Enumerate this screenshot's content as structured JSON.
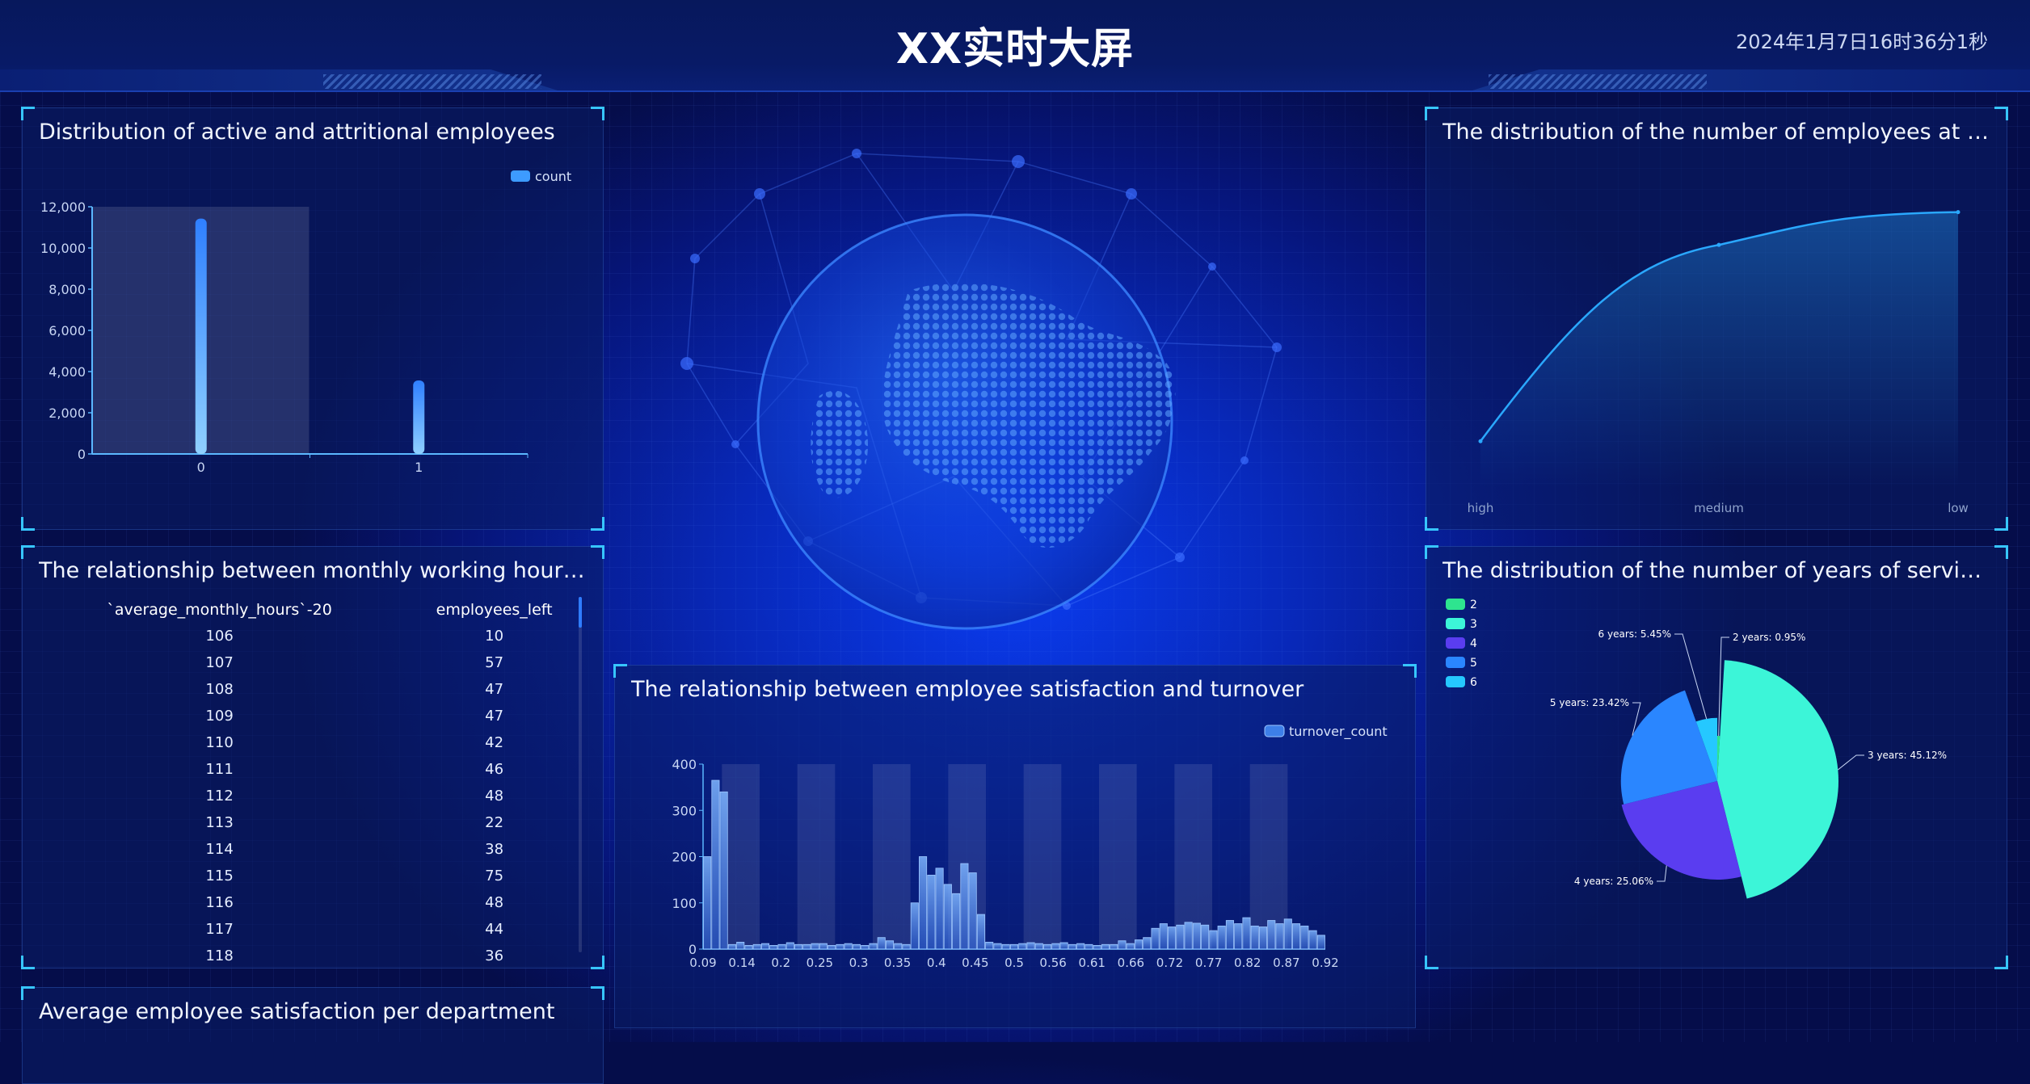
{
  "header": {
    "title": "XX实时大屏",
    "datetime": "2024年1月7日16时36分1秒"
  },
  "panels": {
    "bar": {
      "title": "Distribution of active and attritional employees"
    },
    "line": {
      "title": "The distribution of the number of employees at differ..."
    },
    "table": {
      "title": "The relationship between monthly working hours and ..."
    },
    "pie": {
      "title": "The distribution of the number of years of service of t..."
    },
    "hist": {
      "title": "The relationship between employee satisfaction and turnover"
    },
    "dept": {
      "title": "Average employee satisfaction per department"
    }
  },
  "table": {
    "columns": [
      "`average_monthly_hours`-20",
      "employees_left"
    ],
    "rows": [
      [
        "106",
        "10"
      ],
      [
        "107",
        "57"
      ],
      [
        "108",
        "47"
      ],
      [
        "109",
        "47"
      ],
      [
        "110",
        "42"
      ],
      [
        "111",
        "46"
      ],
      [
        "112",
        "48"
      ],
      [
        "113",
        "22"
      ],
      [
        "114",
        "38"
      ],
      [
        "115",
        "75"
      ],
      [
        "116",
        "48"
      ],
      [
        "117",
        "44"
      ],
      [
        "118",
        "36"
      ]
    ]
  },
  "colors": {
    "accent": "#37c6ff",
    "bar": "#3d9bff",
    "pie": [
      "#2ee48f",
      "#3cf5d8",
      "#5a3df0",
      "#2a86ff",
      "#25c8ff"
    ]
  },
  "chart_data": [
    {
      "id": "attrition",
      "type": "bar",
      "categories": [
        "0",
        "1"
      ],
      "series": [
        {
          "name": "count",
          "values": [
            11428,
            3571
          ]
        }
      ],
      "yticks": [
        "0",
        "2,000",
        "4,000",
        "6,000",
        "8,000",
        "10,000",
        "12,000"
      ],
      "ylim": [
        0,
        12000
      ],
      "legend": "top-right"
    },
    {
      "id": "salary",
      "type": "line",
      "categories": [
        "high",
        "medium",
        "low"
      ],
      "values": [
        1237,
        6446,
        7316
      ],
      "smooth": true,
      "area": true
    },
    {
      "id": "tenure",
      "type": "pie",
      "rose": true,
      "legend": [
        "2",
        "3",
        "4",
        "5",
        "6"
      ],
      "slices": [
        {
          "category": "2",
          "label": "2 years: 0.95%",
          "value": 0.95
        },
        {
          "category": "3",
          "label": "3 years: 45.12%",
          "value": 45.12
        },
        {
          "category": "4",
          "label": "4 years: 25.06%",
          "value": 25.06
        },
        {
          "category": "5",
          "label": "5 years: 23.42%",
          "value": 23.42
        },
        {
          "category": "6",
          "label": "6 years: 5.45%",
          "value": 5.45
        }
      ]
    },
    {
      "id": "satisfaction",
      "type": "bar",
      "series": [
        {
          "name": "turnover_count",
          "values": [
            200,
            365,
            340,
            10,
            15,
            8,
            10,
            12,
            8,
            10,
            14,
            10,
            10,
            12,
            12,
            8,
            10,
            12,
            10,
            8,
            12,
            25,
            18,
            12,
            10,
            100,
            200,
            160,
            175,
            140,
            120,
            185,
            165,
            75,
            15,
            12,
            10,
            10,
            12,
            14,
            12,
            10,
            12,
            14,
            10,
            12,
            10,
            8,
            10,
            10,
            18,
            12,
            20,
            25,
            45,
            55,
            48,
            52,
            58,
            56,
            52,
            40,
            50,
            62,
            55,
            68,
            50,
            48,
            62,
            55,
            65,
            55,
            50,
            40,
            30
          ]
        }
      ],
      "xticks": [
        "0.09",
        "0.14",
        "0.2",
        "0.25",
        "0.3",
        "0.35",
        "0.4",
        "0.45",
        "0.5",
        "0.56",
        "0.61",
        "0.66",
        "0.72",
        "0.77",
        "0.82",
        "0.87",
        "0.92"
      ],
      "yticks": [
        "0",
        "100",
        "200",
        "300",
        "400"
      ],
      "ylim": [
        0,
        400
      ],
      "legend": "top-right"
    }
  ]
}
